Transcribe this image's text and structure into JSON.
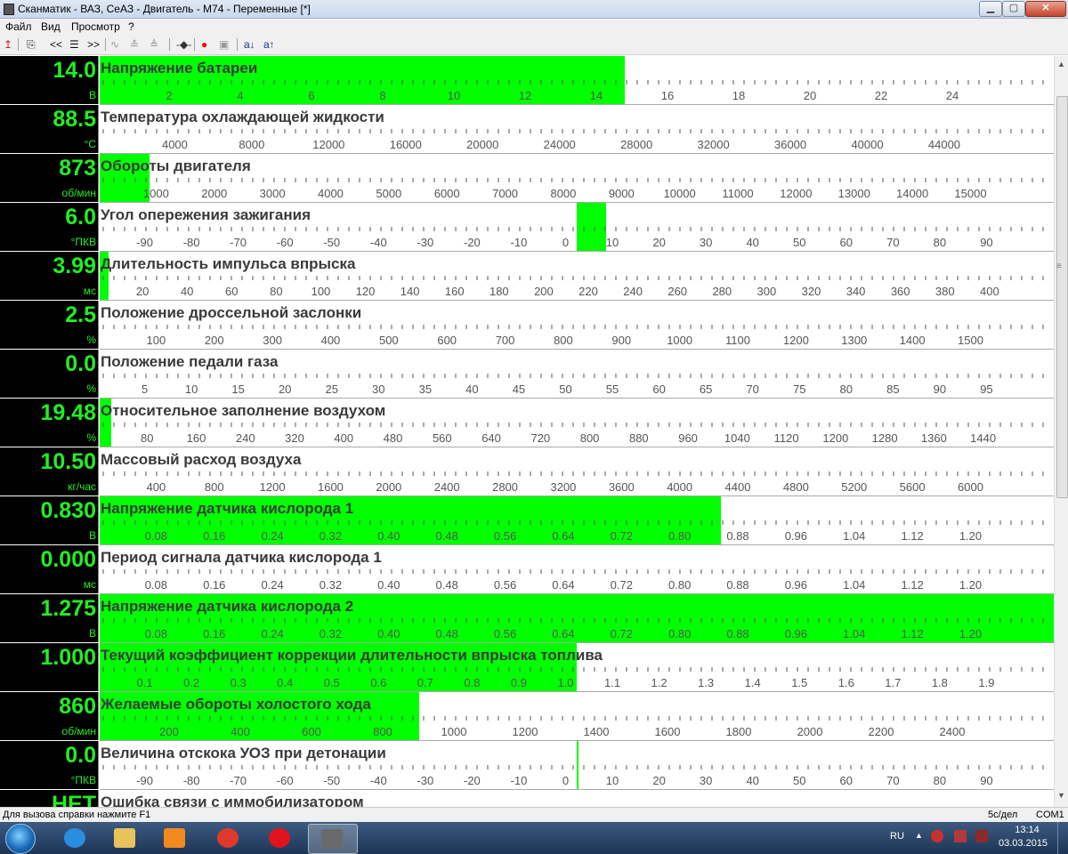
{
  "window": {
    "title": "Сканматик - ВАЗ, СеАЗ - Двигатель - М74 - Переменные [*]",
    "min_label": "▁",
    "max_label": "▢",
    "close_label": "✕"
  },
  "menu": [
    "Файл",
    "Вид",
    "Просмотр",
    "?"
  ],
  "toolbar": {
    "items": [
      {
        "icon": "red-arrow-icon",
        "label": "↥",
        "color": "#d42020"
      },
      {
        "icon": "clipboard-icon",
        "label": "⎘",
        "color": "#333"
      },
      {
        "icon": "prev-icon",
        "label": "<<",
        "color": "#111"
      },
      {
        "icon": "list-icon",
        "label": "☰",
        "color": "#111"
      },
      {
        "icon": "next-icon",
        "label": ">>",
        "color": "#111"
      },
      {
        "icon": "wave-icon",
        "label": "∿",
        "color": "#999"
      },
      {
        "icon": "stack-icon",
        "label": "≛",
        "color": "#999"
      },
      {
        "icon": "stack-down-icon",
        "label": "≜",
        "color": "#999"
      },
      {
        "icon": "probe-icon",
        "label": "-◆-",
        "color": "#333"
      },
      {
        "icon": "record-icon",
        "label": "●",
        "color": "#e01010"
      },
      {
        "icon": "save-icon",
        "label": "▣",
        "color": "#999"
      },
      {
        "icon": "sort-down-icon",
        "label": "a↓",
        "color": "#113399"
      },
      {
        "icon": "sort-up-icon",
        "label": "a↑",
        "color": "#113399"
      }
    ]
  },
  "colors": {
    "bar": "#00ff00",
    "value": "#22ee22",
    "panel_bg": "#000000"
  },
  "gauges": [
    {
      "value": "14.0",
      "unit": "В",
      "name": "Напряжение батареи",
      "fill": 0.55,
      "labels": [
        "2",
        "4",
        "6",
        "8",
        "10",
        "12",
        "14",
        "16",
        "18",
        "20",
        "22",
        "24"
      ]
    },
    {
      "value": "88.5",
      "unit": "°С",
      "name": "Температура охлаждающей жидкости",
      "fill": 0,
      "labels": [
        "4000",
        "8000",
        "12000",
        "16000",
        "20000",
        "24000",
        "28000",
        "32000",
        "36000",
        "40000",
        "44000"
      ]
    },
    {
      "value": "873",
      "unit": "об/мин",
      "name": "Обороты  двигателя",
      "fill": 0.052,
      "labels": [
        "1000",
        "2000",
        "3000",
        "4000",
        "5000",
        "6000",
        "7000",
        "8000",
        "9000",
        "10000",
        "11000",
        "12000",
        "13000",
        "14000",
        "15000"
      ]
    },
    {
      "value": "6.0",
      "unit": "°ПКВ",
      "name": "Угол опережения зажигания",
      "fill": 0,
      "center_fill": {
        "from": 0.5,
        "to": 0.531
      },
      "labels": [
        "-90",
        "-80",
        "-70",
        "-60",
        "-50",
        "-40",
        "-30",
        "-20",
        "-10",
        "0",
        "10",
        "20",
        "30",
        "40",
        "50",
        "60",
        "70",
        "80",
        "90"
      ]
    },
    {
      "value": "3.99",
      "unit": "мс",
      "name": "Длительность импульса впрыска",
      "fill": 0.009,
      "labels": [
        "20",
        "40",
        "60",
        "80",
        "100",
        "120",
        "140",
        "160",
        "180",
        "200",
        "220",
        "240",
        "260",
        "280",
        "300",
        "320",
        "340",
        "360",
        "380",
        "400"
      ]
    },
    {
      "value": "2.5",
      "unit": "%",
      "name": "Положение дроссельной заслонки",
      "fill": 0,
      "labels": [
        "100",
        "200",
        "300",
        "400",
        "500",
        "600",
        "700",
        "800",
        "900",
        "1000",
        "1100",
        "1200",
        "1300",
        "1400",
        "1500"
      ]
    },
    {
      "value": "0.0",
      "unit": "%",
      "name": "Положение педали газа",
      "fill": 0,
      "labels": [
        "5",
        "10",
        "15",
        "20",
        "25",
        "30",
        "35",
        "40",
        "45",
        "50",
        "55",
        "60",
        "65",
        "70",
        "75",
        "80",
        "85",
        "90",
        "95"
      ]
    },
    {
      "value": "19.48",
      "unit": "%",
      "name": "Относительное заполнение воздухом",
      "fill": 0.012,
      "labels": [
        "80",
        "160",
        "240",
        "320",
        "400",
        "480",
        "560",
        "640",
        "720",
        "800",
        "880",
        "960",
        "1040",
        "1120",
        "1200",
        "1280",
        "1360",
        "1440"
      ]
    },
    {
      "value": "10.50",
      "unit": "кг/час",
      "name": "Массовый расход воздуха",
      "fill": 0,
      "labels": [
        "400",
        "800",
        "1200",
        "1600",
        "2000",
        "2400",
        "2800",
        "3200",
        "3600",
        "4000",
        "4400",
        "4800",
        "5200",
        "5600",
        "6000"
      ]
    },
    {
      "value": "0.830",
      "unit": "В",
      "name": "Напряжение датчика кислорода 1",
      "fill": 0.651,
      "labels": [
        "0.08",
        "0.16",
        "0.24",
        "0.32",
        "0.40",
        "0.48",
        "0.56",
        "0.64",
        "0.72",
        "0.80",
        "0.88",
        "0.96",
        "1.04",
        "1.12",
        "1.20"
      ]
    },
    {
      "value": "0.000",
      "unit": "мс",
      "name": "Период сигнала датчика кислорода 1",
      "fill": 0,
      "labels": [
        "0.08",
        "0.16",
        "0.24",
        "0.32",
        "0.40",
        "0.48",
        "0.56",
        "0.64",
        "0.72",
        "0.80",
        "0.88",
        "0.96",
        "1.04",
        "1.12",
        "1.20"
      ]
    },
    {
      "value": "1.275",
      "unit": "В",
      "name": "Напряжение датчика кислорода 2",
      "fill": 1.0,
      "labels": [
        "0.08",
        "0.16",
        "0.24",
        "0.32",
        "0.40",
        "0.48",
        "0.56",
        "0.64",
        "0.72",
        "0.80",
        "0.88",
        "0.96",
        "1.04",
        "1.12",
        "1.20"
      ]
    },
    {
      "value": "1.000",
      "unit": "",
      "name": "Текущий коэффициент коррекции длительности впрыска топлива",
      "fill": 0.5,
      "labels": [
        "0.1",
        "0.2",
        "0.3",
        "0.4",
        "0.5",
        "0.6",
        "0.7",
        "0.8",
        "0.9",
        "1.0",
        "1.1",
        "1.2",
        "1.3",
        "1.4",
        "1.5",
        "1.6",
        "1.7",
        "1.8",
        "1.9"
      ]
    },
    {
      "value": "860",
      "unit": "об/мин",
      "name": "Желаемые обороты холостого хода",
      "fill": 0.335,
      "labels": [
        "200",
        "400",
        "600",
        "800",
        "1000",
        "1200",
        "1400",
        "1600",
        "1800",
        "2000",
        "2200",
        "2400"
      ]
    },
    {
      "value": "0.0",
      "unit": "°ПКВ",
      "name": "Величина отскока УОЗ при детонации",
      "fill": 0,
      "center_fill": {
        "from": 0.5,
        "to": 0.502
      },
      "labels": [
        "-90",
        "-80",
        "-70",
        "-60",
        "-50",
        "-40",
        "-30",
        "-20",
        "-10",
        "0",
        "10",
        "20",
        "30",
        "40",
        "50",
        "60",
        "70",
        "80",
        "90"
      ]
    },
    {
      "value": "НЕТ",
      "unit": "",
      "name": "Ошибка связи с иммобилизатором",
      "fill": 0,
      "labels": []
    }
  ],
  "status": {
    "help": "Для вызова справки нажмите F1",
    "speed": "5с/дел",
    "port": "COM1"
  },
  "taskbar": {
    "apps": [
      {
        "icon": "internet-explorer-icon",
        "color": "#2a8ee0"
      },
      {
        "icon": "file-explorer-icon",
        "color": "#e8c25a"
      },
      {
        "icon": "media-player-icon",
        "color": "#f08a1e"
      },
      {
        "icon": "chrome-icon",
        "color": "#dd3a2d"
      },
      {
        "icon": "opera-icon",
        "color": "#e0141e"
      },
      {
        "icon": "scanmatik-icon",
        "color": "#6a6a6a",
        "active": true
      }
    ],
    "lang": "RU",
    "time": "13:14",
    "date": "03.03.2015"
  }
}
